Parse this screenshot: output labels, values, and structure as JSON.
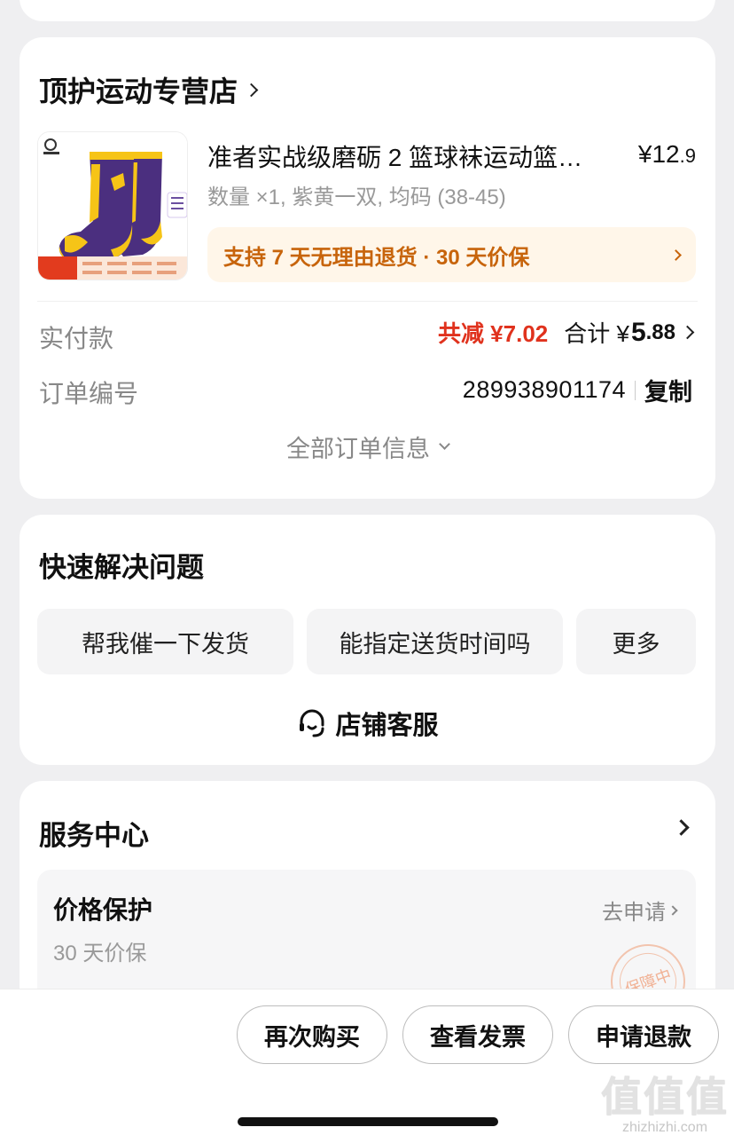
{
  "order": {
    "store_name": "顶护运动专营店",
    "product": {
      "title": "准者实战级磨砺 2 篮球袜运动篮球袜",
      "price_symbol": "¥",
      "price_int": "12",
      "price_cents": ".9",
      "spec": "数量 ×1, 紫黄一双, 均码 (38-45)",
      "promise": "支持 7 天无理由退货 · 30 天价保"
    },
    "paid_label": "实付款",
    "discount": "共减 ¥7.02",
    "total_label": "合计 ¥",
    "total_int": "5",
    "total_cents": ".88",
    "order_no_label": "订单编号",
    "order_no": "289938901174",
    "copy_label": "复制",
    "all_info_label": "全部订单信息"
  },
  "quick": {
    "title": "快速解决问题",
    "chips": [
      "帮我催一下发货",
      "能指定送货时间吗",
      "更多"
    ],
    "customer_service": "店铺客服"
  },
  "service": {
    "title": "服务中心",
    "price_protect": {
      "title": "价格保护",
      "subtitle": "30 天价保",
      "apply": "去申请",
      "stamp": "保障中"
    }
  },
  "actions": [
    "再次购买",
    "查看发票",
    "申请退款"
  ],
  "watermark": {
    "logo": "值值值",
    "site": "zhizhizhi.com"
  },
  "colors": {
    "discount_red": "#e0321d",
    "promise_orange": "#c7640b",
    "sock_purple": "#4b2f7f",
    "sock_yellow": "#f6c417"
  }
}
